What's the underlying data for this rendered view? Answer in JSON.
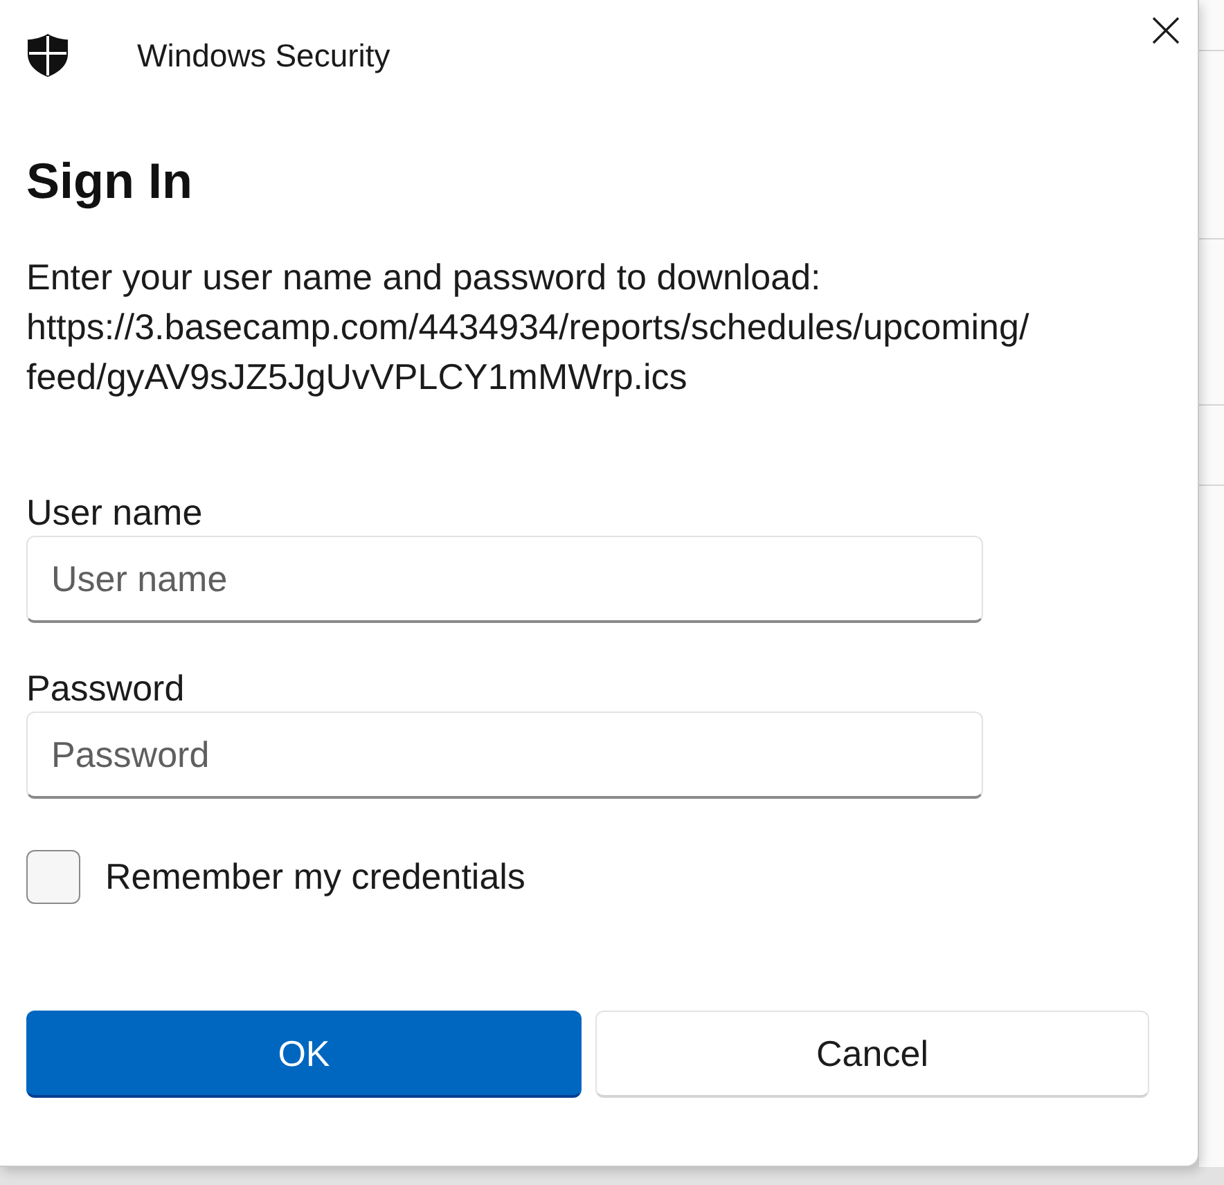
{
  "window": {
    "title": "Windows Security"
  },
  "dialog": {
    "heading": "Sign In",
    "prompt": "Enter your user name and password to download:",
    "url": "https://3.basecamp.com/4434934/reports/schedules/upcoming/feed/gyAV9sJZ5JgUvVPLCY1mMWrp.ics"
  },
  "fields": [
    {
      "label": "User name",
      "placeholder": "User name"
    },
    {
      "label": "Password",
      "placeholder": "Password"
    }
  ],
  "remember": {
    "label": "Remember my credentials",
    "checked": false
  },
  "buttons": [
    {
      "label": "OK",
      "kind": "primary"
    },
    {
      "label": "Cancel",
      "kind": "secondary"
    }
  ]
}
